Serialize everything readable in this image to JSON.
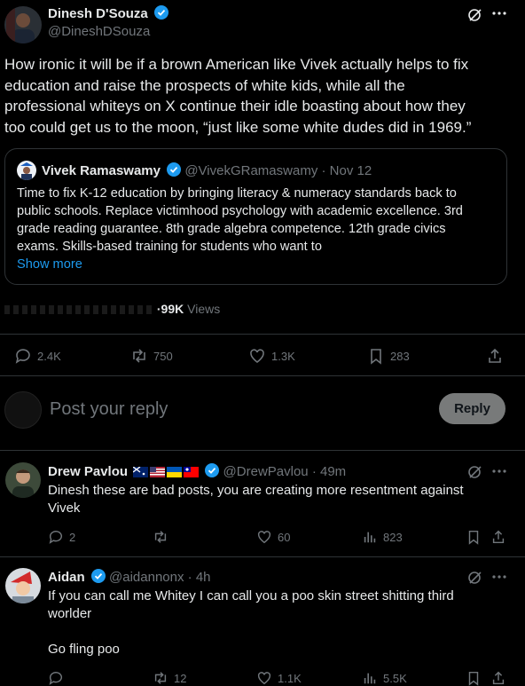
{
  "main_post": {
    "author_name": "Dinesh D'Souza",
    "author_handle": "@DineshDSouza",
    "text_lines": [
      "How ironic it will be if a brown American like Vivek actually helps to fix",
      "education and raise the prospects of white kids, while all the",
      "professional whiteys on X continue their idle boasting about how they",
      "too could get us to the moon, “just like some white dudes did in 1969.”"
    ],
    "quoted": {
      "author_name": "Vivek Ramaswamy",
      "author_handle": "@VivekGRamaswamy",
      "date": "· Nov 12",
      "text_lines": [
        "Time to fix K-12 education by bringing literacy & numeracy standards back to",
        "public schools. Replace victimhood psychology with academic excellence. 3rd",
        "grade reading guarantee. 8th grade algebra competence. 12th grade civics",
        "exams. Skills-based training for students who want to"
      ],
      "show_more": "Show more"
    },
    "views_count": "·99K",
    "views_label": "Views",
    "stats": {
      "replies": "2.4K",
      "reposts": "750",
      "likes": "1.3K",
      "bookmarks": "283"
    }
  },
  "compose": {
    "placeholder": "Post your reply",
    "reply_button": "Reply"
  },
  "replies": [
    {
      "author_name": "Drew Pavlou",
      "author_handle": "@DrewPavlou",
      "time": "· 49m",
      "text_lines": [
        "Dinesh these are bad posts, you are creating more resentment against",
        "Vivek"
      ],
      "stats": {
        "replies": "2",
        "reposts": "",
        "likes": "60",
        "views": "823"
      }
    },
    {
      "author_name": "Aidan",
      "author_handle": "@aidannonx",
      "time": "· 4h",
      "text_lines": [
        "If you can call me Whitey I can call you a poo skin street shitting third",
        "worlder",
        "",
        "Go fling poo"
      ],
      "stats": {
        "replies": "",
        "reposts": "12",
        "likes": "1.1K",
        "views": "5.5K"
      }
    }
  ],
  "colors": {
    "background": "#000000",
    "text": "#e7e9ea",
    "muted": "#71767b",
    "accent": "#1d9bf0",
    "divider": "#2f3336",
    "reply_button": "#787a7a"
  },
  "icons": [
    "verified-badge-icon",
    "grok-icon",
    "more-icon",
    "reply-icon",
    "repost-icon",
    "like-icon",
    "bookmark-icon",
    "share-icon",
    "views-icon"
  ]
}
